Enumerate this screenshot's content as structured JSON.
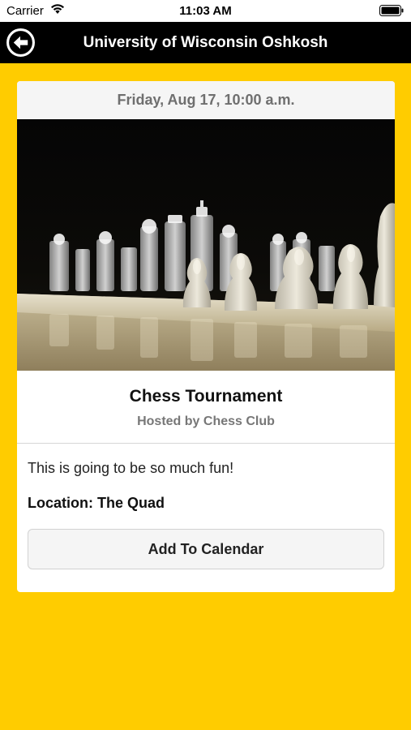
{
  "status_bar": {
    "carrier": "Carrier",
    "time": "11:03 AM",
    "wifi_icon": "wifi-icon",
    "battery_icon": "battery-icon"
  },
  "nav": {
    "title": "University of Wisconsin Oshkosh",
    "back_icon": "back-arrow-icon",
    "background": "#000000"
  },
  "event": {
    "date": "Friday, Aug 17, 10:00 a.m.",
    "image": "chess-pieces-photo",
    "title": "Chess Tournament",
    "host": "Hosted by Chess Club",
    "description": "This is going to be so much fun!",
    "location": "Location: The Quad",
    "add_button_label": "Add To Calendar"
  },
  "colors": {
    "accent": "#FFCC00",
    "card": "#FFFFFF",
    "muted_text": "#777777"
  }
}
